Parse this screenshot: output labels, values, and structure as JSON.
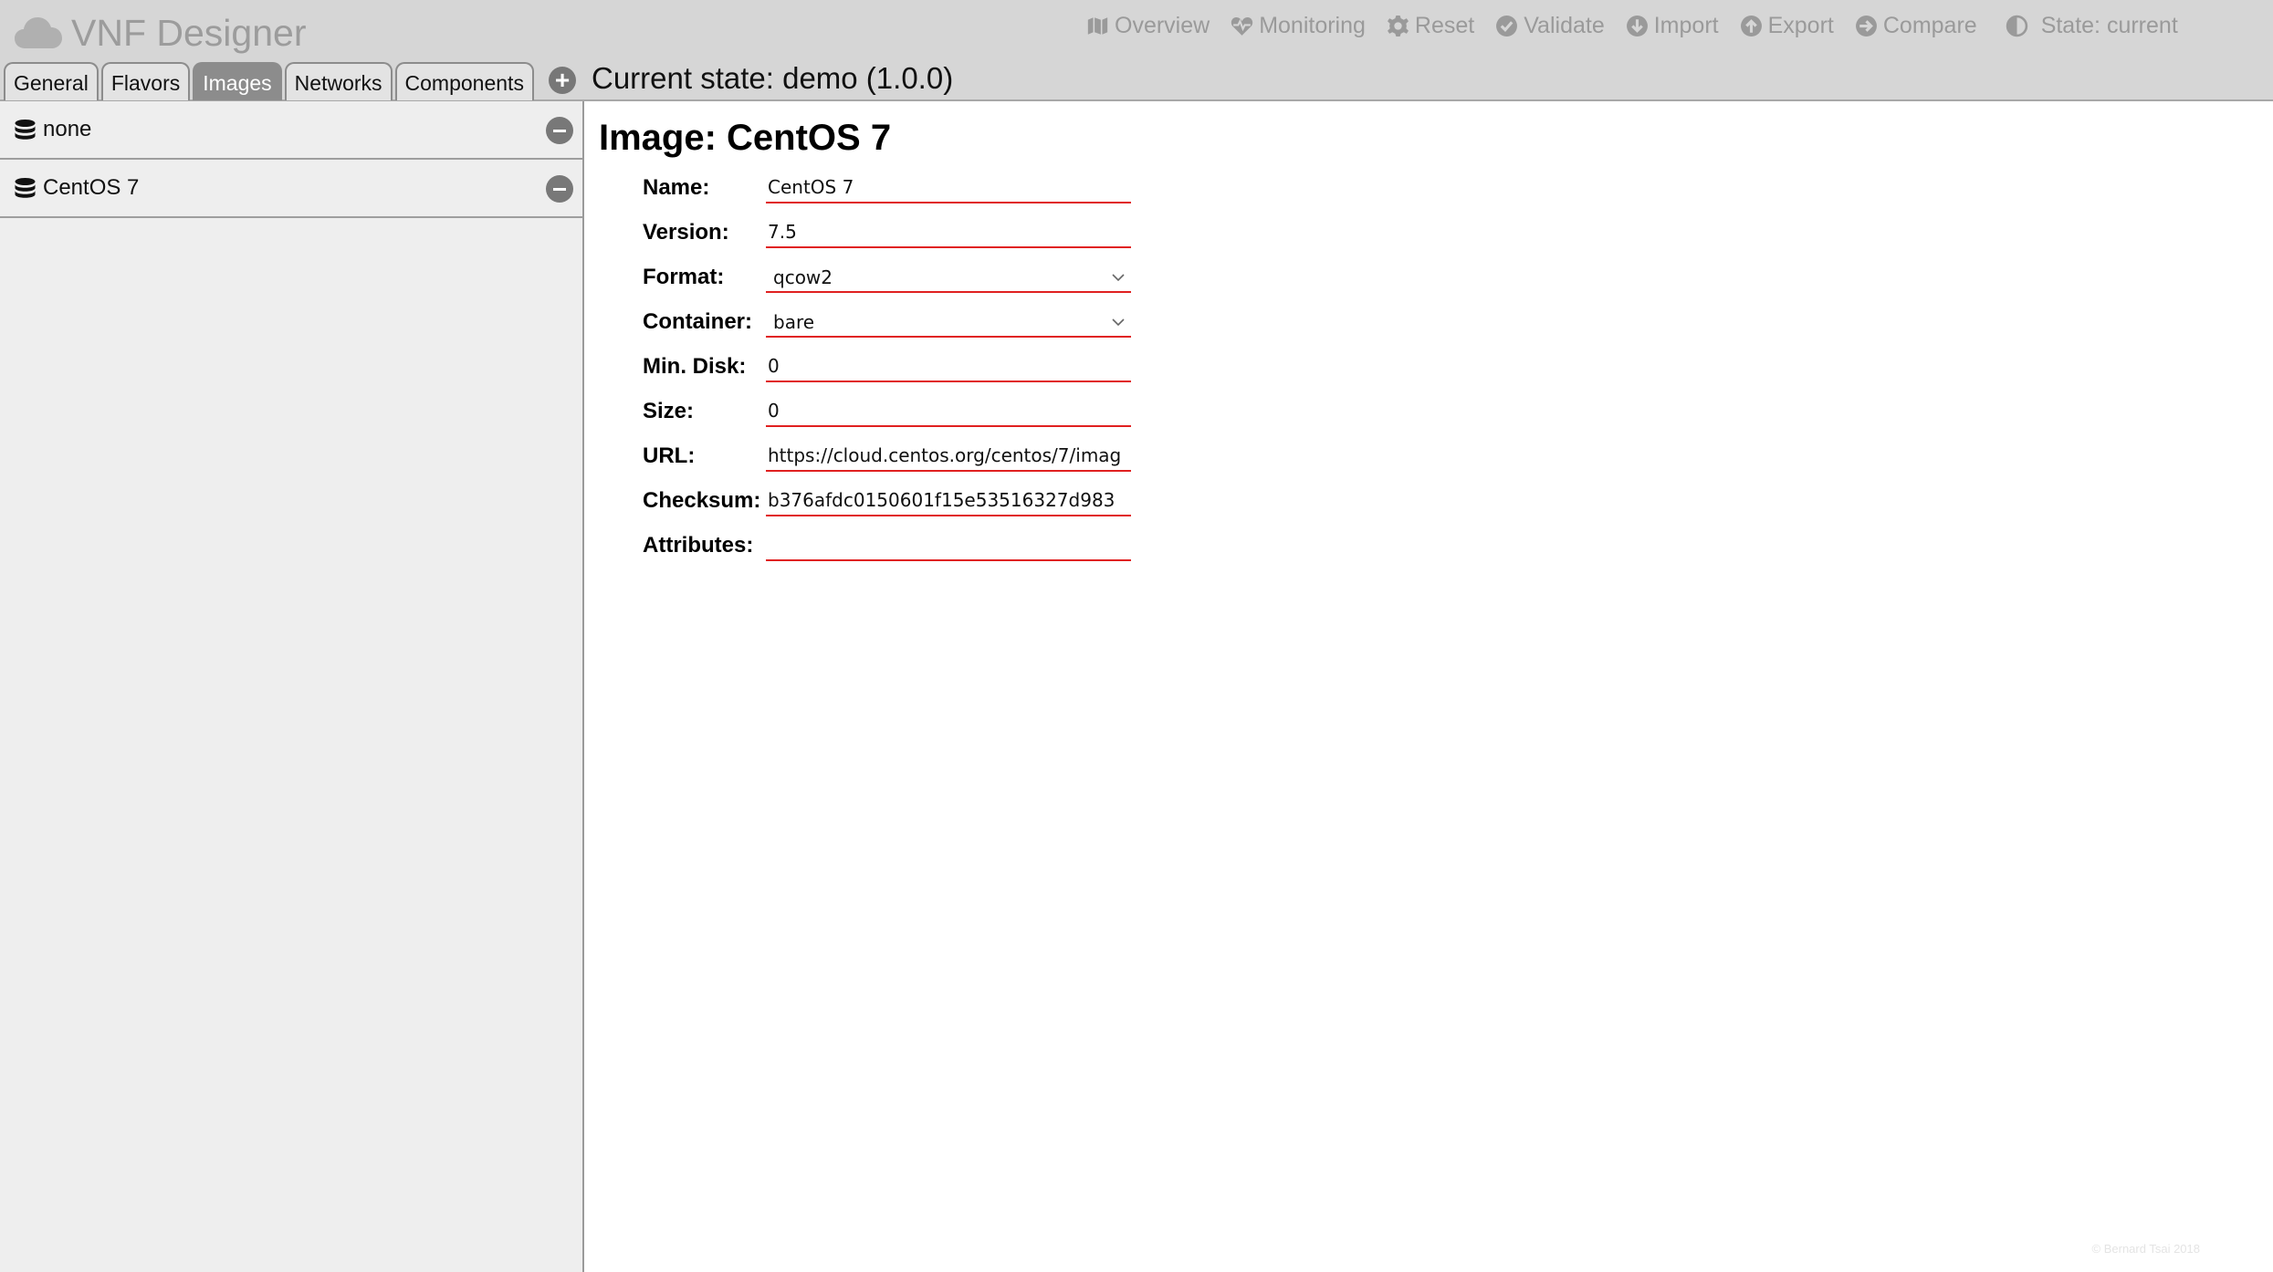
{
  "app": {
    "title": "VNF Designer"
  },
  "topnav": [
    {
      "label": "Overview",
      "icon": "map-icon"
    },
    {
      "label": "Monitoring",
      "icon": "heartbeat-icon"
    },
    {
      "label": "Reset",
      "icon": "gear-icon"
    },
    {
      "label": "Validate",
      "icon": "check-circle-icon"
    },
    {
      "label": "Import",
      "icon": "arrow-down-circle-icon"
    },
    {
      "label": "Export",
      "icon": "arrow-up-circle-icon"
    },
    {
      "label": "Compare",
      "icon": "arrow-right-circle-icon"
    }
  ],
  "state_toggle": {
    "label": "State: current",
    "icon": "half-circle-icon"
  },
  "tabs": [
    {
      "label": "General",
      "active": false
    },
    {
      "label": "Flavors",
      "active": false
    },
    {
      "label": "Images",
      "active": true
    },
    {
      "label": "Networks",
      "active": false
    },
    {
      "label": "Components",
      "active": false
    }
  ],
  "current_state": "Current state: demo (1.0.0)",
  "sidebar": {
    "items": [
      {
        "label": "none",
        "icon": "database-icon"
      },
      {
        "label": "CentOS 7",
        "icon": "database-icon"
      }
    ]
  },
  "main": {
    "title": "Image: CentOS 7",
    "fields": {
      "name": {
        "label": "Name:",
        "value": "CentOS 7"
      },
      "version": {
        "label": "Version:",
        "value": "7.5"
      },
      "format": {
        "label": "Format:",
        "value": "qcow2"
      },
      "container": {
        "label": "Container:",
        "value": "bare"
      },
      "min_disk": {
        "label": "Min. Disk:",
        "value": "0"
      },
      "size": {
        "label": "Size:",
        "value": "0"
      },
      "url": {
        "label": "URL:",
        "value": "https://cloud.centos.org/centos/7/imag"
      },
      "checksum": {
        "label": "Checksum:",
        "value": "b376afdc0150601f15e53516327d983"
      },
      "attributes": {
        "label": "Attributes:",
        "value": ""
      }
    }
  },
  "footer": "© Bernard Tsai 2018",
  "colors": {
    "header_bg": "#d6d6d6",
    "sidebar_bg": "#eeeeee",
    "active_tab": "#8c8c8c",
    "input_underline": "#e02020"
  }
}
